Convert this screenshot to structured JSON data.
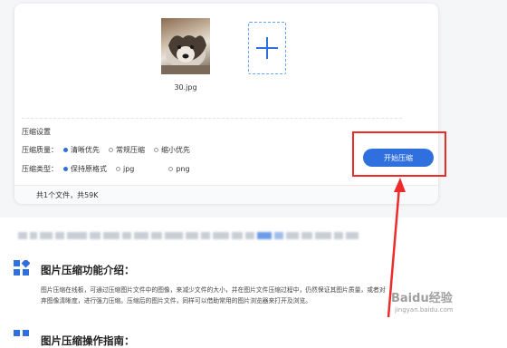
{
  "upload": {
    "file_name": "30.jpg",
    "add_icon": "plus-icon"
  },
  "settings": {
    "title": "压缩设置",
    "quality_label": "压缩质量：",
    "quality_options": [
      "清晰优先",
      "常规压缩",
      "缩小优先"
    ],
    "quality_selected": "清晰优先",
    "type_label": "压缩类型：",
    "type_options": [
      "保持原格式",
      "jpg",
      "png"
    ],
    "type_selected": "保持原格式"
  },
  "start_button": "开始压缩",
  "summary": "共1个文件，共59K",
  "intro": {
    "title": "图片压缩功能介绍：",
    "line1": "图片压缩在线板，可通过压缩图片文件中的图像，来减少文件的大小，并在图片文件压缩过程中，仍然保证其图片质量，或者对",
    "line2": "弃图像清晰度，进行强力压缩。压缩后的图片文件，同样可以借助常用的图片浏览器来打开及浏览。"
  },
  "guide": {
    "title": "图片压缩操作指南："
  },
  "watermark": {
    "brand": "Baidu经验",
    "url": "jingyan.baidu.com"
  },
  "colors": {
    "accent": "#2f6fde",
    "highlight": "#ee2a2a"
  }
}
